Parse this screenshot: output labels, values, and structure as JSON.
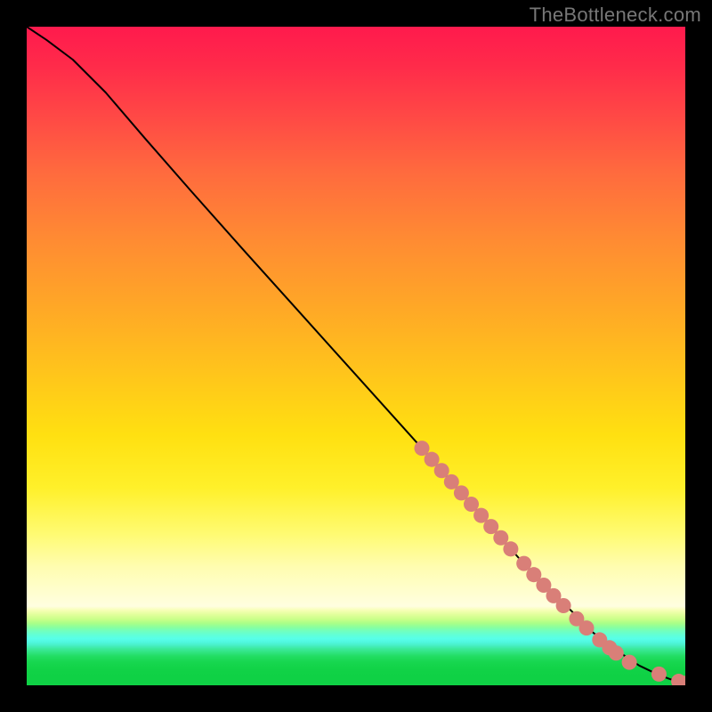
{
  "watermark": "TheBottleneck.com",
  "chart_data": {
    "type": "line",
    "title": "",
    "xlabel": "",
    "ylabel": "",
    "xlim": [
      0,
      100
    ],
    "ylim": [
      0,
      100
    ],
    "grid": false,
    "legend": false,
    "curve": {
      "name": "bottleneck-curve",
      "x": [
        0,
        3,
        7,
        12,
        18,
        25,
        33,
        42,
        51,
        60,
        68,
        75,
        81,
        86,
        90,
        93,
        95.5,
        97.5,
        99,
        100
      ],
      "y": [
        100,
        98,
        95,
        90,
        83,
        75,
        66,
        56,
        46,
        36,
        27,
        19,
        13,
        8,
        5,
        3,
        1.8,
        1,
        0.5,
        0.3
      ]
    },
    "series": [
      {
        "name": "scatter-points",
        "type": "scatter",
        "color": "#d97f78",
        "x": [
          60,
          61.5,
          63,
          64.5,
          66,
          67.5,
          69,
          70.5,
          72,
          73.5,
          75.5,
          77,
          78.5,
          80,
          81.5,
          83.5,
          85,
          87,
          88.5,
          89.5,
          91.5,
          96,
          99,
          100
        ],
        "y": [
          36,
          34.3,
          32.6,
          30.9,
          29.2,
          27.5,
          25.8,
          24.1,
          22.4,
          20.7,
          18.5,
          16.8,
          15.2,
          13.6,
          12.1,
          10.1,
          8.7,
          6.9,
          5.7,
          4.9,
          3.5,
          1.7,
          0.6,
          0.3
        ]
      }
    ]
  }
}
